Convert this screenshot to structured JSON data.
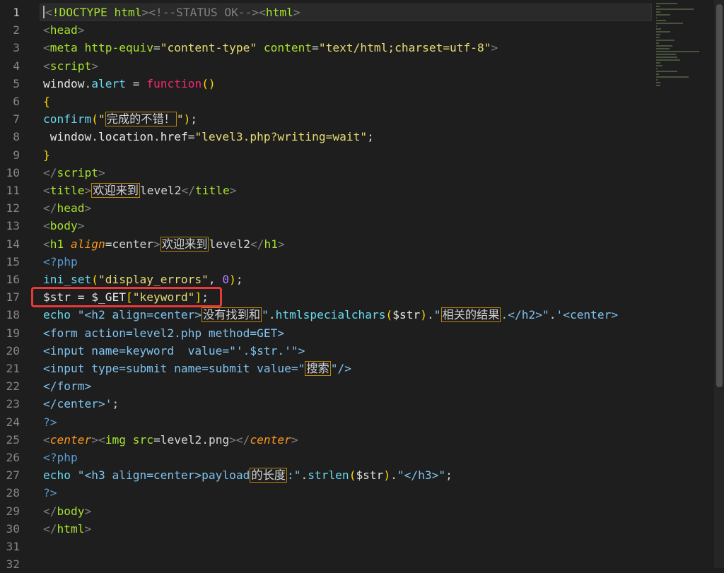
{
  "lines": [
    {
      "n": "1",
      "active": true,
      "tokens": [
        [
          "p",
          "<"
        ],
        [
          "tag",
          "!DOCTYPE"
        ],
        [
          "plain",
          " "
        ],
        [
          "tag",
          "html"
        ],
        [
          "p",
          "><!--STATUS OK--><"
        ],
        [
          "tag",
          "html"
        ],
        [
          "p",
          ">"
        ]
      ]
    },
    {
      "n": "2",
      "tokens": [
        [
          "p",
          "<"
        ],
        [
          "tag",
          "head"
        ],
        [
          "p",
          ">"
        ]
      ]
    },
    {
      "n": "3",
      "tokens": [
        [
          "p",
          "<"
        ],
        [
          "tag",
          "meta"
        ],
        [
          "plain",
          " "
        ],
        [
          "attr",
          "http-equiv"
        ],
        [
          "plain",
          "="
        ],
        [
          "str",
          "\"content-type\""
        ],
        [
          "plain",
          " "
        ],
        [
          "attr",
          "content"
        ],
        [
          "plain",
          "="
        ],
        [
          "str",
          "\"text/html;charset=utf-8\""
        ],
        [
          "p",
          ">"
        ]
      ]
    },
    {
      "n": "4",
      "tokens": [
        [
          "p",
          "<"
        ],
        [
          "tag",
          "script"
        ],
        [
          "p",
          ">"
        ]
      ]
    },
    {
      "n": "5",
      "tokens": [
        [
          "id",
          "window"
        ],
        [
          "plain",
          "."
        ],
        [
          "fn",
          "alert"
        ],
        [
          "plain",
          " = "
        ],
        [
          "kw",
          "function"
        ],
        [
          "brace",
          "()"
        ]
      ]
    },
    {
      "n": "6",
      "tokens": [
        [
          "brace",
          "{"
        ]
      ]
    },
    {
      "n": "7",
      "tokens": [
        [
          "fn",
          "confirm"
        ],
        [
          "brace",
          "("
        ],
        [
          "str",
          "\""
        ],
        [
          "cn",
          "完成的不错！"
        ],
        [
          "str",
          "\""
        ],
        [
          "brace",
          ")"
        ],
        [
          "plain",
          ";"
        ]
      ]
    },
    {
      "n": "8",
      "tokens": [
        [
          "plain",
          " "
        ],
        [
          "id",
          "window"
        ],
        [
          "plain",
          "."
        ],
        [
          "id",
          "location"
        ],
        [
          "plain",
          "."
        ],
        [
          "id",
          "href"
        ],
        [
          "plain",
          "="
        ],
        [
          "str",
          "\"level3.php?writing=wait\""
        ],
        [
          "plain",
          ";"
        ]
      ]
    },
    {
      "n": "9",
      "tokens": [
        [
          "brace",
          "}"
        ]
      ]
    },
    {
      "n": "10",
      "tokens": [
        [
          "p",
          "</"
        ],
        [
          "tag",
          "script"
        ],
        [
          "p",
          ">"
        ]
      ]
    },
    {
      "n": "11",
      "tokens": [
        [
          "p",
          "<"
        ],
        [
          "tag",
          "title"
        ],
        [
          "p",
          ">"
        ],
        [
          "cn",
          "欢迎来到"
        ],
        [
          "plain",
          "level2"
        ],
        [
          "p",
          "</"
        ],
        [
          "tag",
          "title"
        ],
        [
          "p",
          ">"
        ]
      ]
    },
    {
      "n": "12",
      "tokens": [
        [
          "p",
          "</"
        ],
        [
          "tag",
          "head"
        ],
        [
          "p",
          ">"
        ]
      ]
    },
    {
      "n": "13",
      "tokens": [
        [
          "p",
          "<"
        ],
        [
          "tag",
          "body"
        ],
        [
          "p",
          ">"
        ]
      ]
    },
    {
      "n": "14",
      "tokens": [
        [
          "p",
          "<"
        ],
        [
          "tag",
          "h1"
        ],
        [
          "plain",
          " "
        ],
        [
          "attrit",
          "align"
        ],
        [
          "plain",
          "=center"
        ],
        [
          "p",
          ">"
        ],
        [
          "cn",
          "欢迎来到"
        ],
        [
          "plain",
          "level2"
        ],
        [
          "p",
          "</"
        ],
        [
          "tag",
          "h1"
        ],
        [
          "p",
          ">"
        ]
      ]
    },
    {
      "n": "15",
      "tokens": [
        [
          "php",
          "<?php"
        ]
      ]
    },
    {
      "n": "16",
      "tokens": [
        [
          "fn",
          "ini_set"
        ],
        [
          "brace",
          "("
        ],
        [
          "str",
          "\"display_errors\""
        ],
        [
          "plain",
          ", "
        ],
        [
          "num",
          "0"
        ],
        [
          "brace",
          ")"
        ],
        [
          "plain",
          ";"
        ]
      ]
    },
    {
      "n": "17",
      "tokens": [
        [
          "id",
          "$str"
        ],
        [
          "plain",
          " = "
        ],
        [
          "id",
          "$_GET"
        ],
        [
          "brace",
          "["
        ],
        [
          "str",
          "\"keyword\""
        ],
        [
          "brace",
          "]"
        ],
        [
          "plain",
          ";"
        ]
      ]
    },
    {
      "n": "18",
      "tokens": [
        [
          "fn",
          "echo"
        ],
        [
          "plain",
          " "
        ],
        [
          "strb",
          "\"<h2 align=center>"
        ],
        [
          "cn",
          "没有找到和"
        ],
        [
          "strb",
          "\""
        ],
        [
          "plain",
          "."
        ],
        [
          "fn",
          "htmlspecialchars"
        ],
        [
          "brace",
          "("
        ],
        [
          "id",
          "$str"
        ],
        [
          "brace",
          ")"
        ],
        [
          "plain",
          "."
        ],
        [
          "strb",
          "\""
        ],
        [
          "cn",
          "相关的结果"
        ],
        [
          "strb",
          ".</h2>\""
        ],
        [
          "plain",
          "."
        ],
        [
          "strb",
          "'<center>"
        ]
      ]
    },
    {
      "n": "19",
      "tokens": [
        [
          "strb",
          "<form action=level2.php method=GET>"
        ]
      ]
    },
    {
      "n": "20",
      "tokens": [
        [
          "strb",
          "<input name=keyword  value=\"'.$str.'\">"
        ]
      ]
    },
    {
      "n": "21",
      "tokens": [
        [
          "strb",
          "<input type=submit name=submit value=\""
        ],
        [
          "cn",
          "搜索"
        ],
        [
          "strb",
          "\"/>"
        ]
      ]
    },
    {
      "n": "22",
      "tokens": [
        [
          "strb",
          "</form>"
        ]
      ]
    },
    {
      "n": "23",
      "tokens": [
        [
          "strb",
          "</center>'"
        ],
        [
          "plain",
          ";"
        ]
      ]
    },
    {
      "n": "24",
      "tokens": [
        [
          "php",
          "?>"
        ]
      ]
    },
    {
      "n": "25",
      "tokens": [
        [
          "p",
          "<"
        ],
        [
          "attrit",
          "center"
        ],
        [
          "p",
          "><"
        ],
        [
          "tag",
          "img"
        ],
        [
          "plain",
          " "
        ],
        [
          "attr",
          "src"
        ],
        [
          "plain",
          "=level2.png"
        ],
        [
          "p",
          "></"
        ],
        [
          "attrit",
          "center"
        ],
        [
          "p",
          ">"
        ]
      ]
    },
    {
      "n": "26",
      "tokens": [
        [
          "php",
          "<?php"
        ]
      ]
    },
    {
      "n": "27",
      "tokens": [
        [
          "fn",
          "echo"
        ],
        [
          "plain",
          " "
        ],
        [
          "strb",
          "\"<h3 align=center>payload"
        ],
        [
          "cn",
          "的长度"
        ],
        [
          "strb",
          ":\""
        ],
        [
          "plain",
          "."
        ],
        [
          "fn",
          "strlen"
        ],
        [
          "brace",
          "("
        ],
        [
          "id",
          "$str"
        ],
        [
          "brace",
          ")"
        ],
        [
          "plain",
          "."
        ],
        [
          "strb",
          "\"</h3>\""
        ],
        [
          "plain",
          ";"
        ]
      ]
    },
    {
      "n": "28",
      "tokens": [
        [
          "php",
          "?>"
        ]
      ]
    },
    {
      "n": "29",
      "tokens": [
        [
          "p",
          "</"
        ],
        [
          "tag",
          "body"
        ],
        [
          "p",
          ">"
        ]
      ]
    },
    {
      "n": "30",
      "tokens": [
        [
          "p",
          "</"
        ],
        [
          "tag",
          "html"
        ],
        [
          "p",
          ">"
        ]
      ]
    },
    {
      "n": "31",
      "tokens": []
    },
    {
      "n": "32",
      "tokens": []
    }
  ],
  "highlight_line": "17",
  "colors": {
    "accent_highlight": "#e83838",
    "background": "#1e1e1e"
  }
}
